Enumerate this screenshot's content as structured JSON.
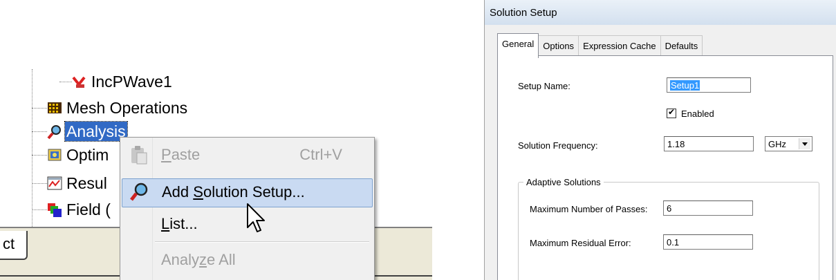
{
  "tree": {
    "items": [
      {
        "label": "IncPWave1",
        "icon": "incident-wave-icon"
      },
      {
        "label": "Mesh Operations",
        "icon": "mesh-operations-icon"
      },
      {
        "label": "Analysis",
        "icon": "analysis-icon",
        "selected": true
      },
      {
        "label": "Optim",
        "icon": "optimetrics-icon"
      },
      {
        "label": "Resul",
        "icon": "results-icon"
      },
      {
        "label": "Field (",
        "icon": "field-overlays-icon"
      }
    ],
    "bottom_tab_label": "ct"
  },
  "context_menu": {
    "paste": {
      "label_pre": "",
      "label_u": "P",
      "label_post": "aste",
      "shortcut": "Ctrl+V",
      "enabled": false
    },
    "add_solution_setup": {
      "label_pre": "Add ",
      "label_u": "S",
      "label_post": "olution Setup...",
      "highlighted": true
    },
    "list": {
      "label_pre": "",
      "label_u": "L",
      "label_post": "ist..."
    },
    "analyze_all": {
      "label_pre": "Analy",
      "label_u": "z",
      "label_post": "e All",
      "enabled": false
    }
  },
  "dialog": {
    "title": "Solution Setup",
    "tabs": [
      "General",
      "Options",
      "Expression Cache",
      "Defaults"
    ],
    "active_tab": "General",
    "setup_name_label": "Setup Name:",
    "setup_name_value": "Setup1",
    "enabled_label": "Enabled",
    "enabled_checked": true,
    "solution_frequency_label": "Solution Frequency:",
    "solution_frequency_value": "1.18",
    "frequency_unit": "GHz",
    "adaptive_group_title": "Adaptive Solutions",
    "max_passes_label": "Maximum Number of Passes:",
    "max_passes_value": "6",
    "max_residual_label": "Maximum Residual Error:",
    "max_residual_value": "0.1"
  },
  "colors": {
    "selection": "#316ac5",
    "menu_highlight": "#c9daf2",
    "text_selection": "#3399ff"
  }
}
